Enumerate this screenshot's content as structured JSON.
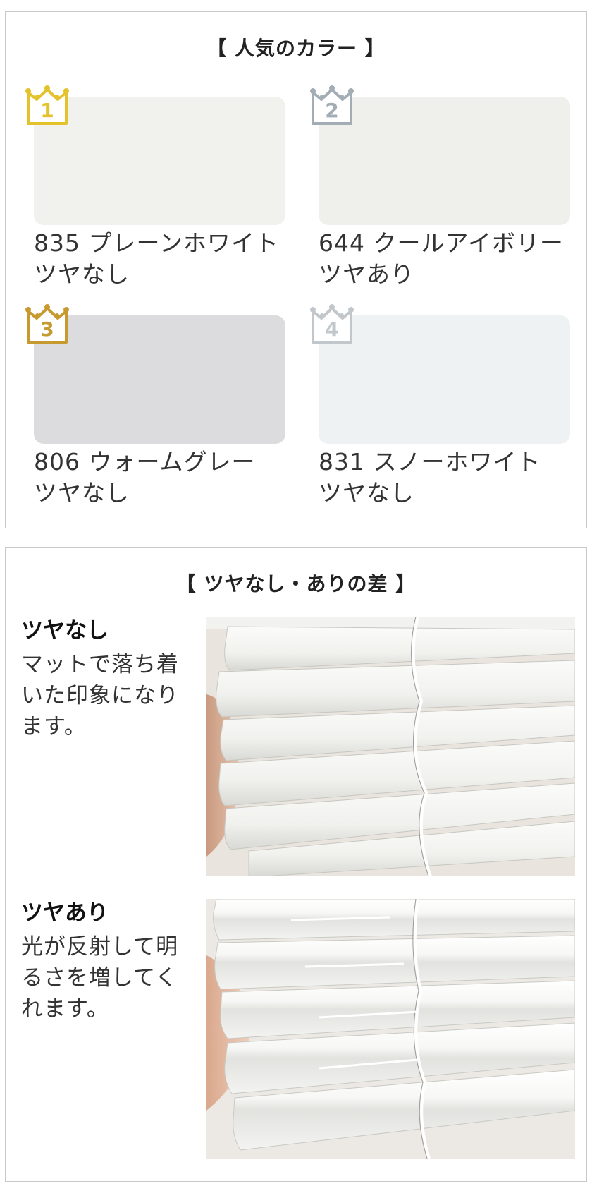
{
  "popular_colors": {
    "title": "【 人気のカラー 】",
    "items": [
      {
        "rank": "1",
        "name": "835 プレーンホワイト",
        "finish": "ツヤなし",
        "swatch_color": "#f1f2ee",
        "crown_color": "#e4c22b"
      },
      {
        "rank": "2",
        "name": "644 クールアイボリー",
        "finish": "ツヤあり",
        "swatch_color": "#efefeb",
        "crown_color": "#a3adb5"
      },
      {
        "rank": "3",
        "name": "806 ウォームグレー",
        "finish": "ツヤなし",
        "swatch_color": "#dcdcde",
        "crown_color": "#c79a30"
      },
      {
        "rank": "4",
        "name": "831 スノーホワイト",
        "finish": "ツヤなし",
        "swatch_color": "#eff2f2",
        "crown_color": "#c2c7cb"
      }
    ]
  },
  "gloss_difference": {
    "title": "【 ツヤなし・ありの差 】",
    "matte": {
      "heading": "ツヤなし",
      "description_lines": [
        "マットで落ち着",
        "いた印象になり",
        "ます。"
      ]
    },
    "glossy": {
      "heading": "ツヤあり",
      "description_lines": [
        "光が反射して明",
        "るさを増してく",
        "れます。"
      ]
    }
  }
}
